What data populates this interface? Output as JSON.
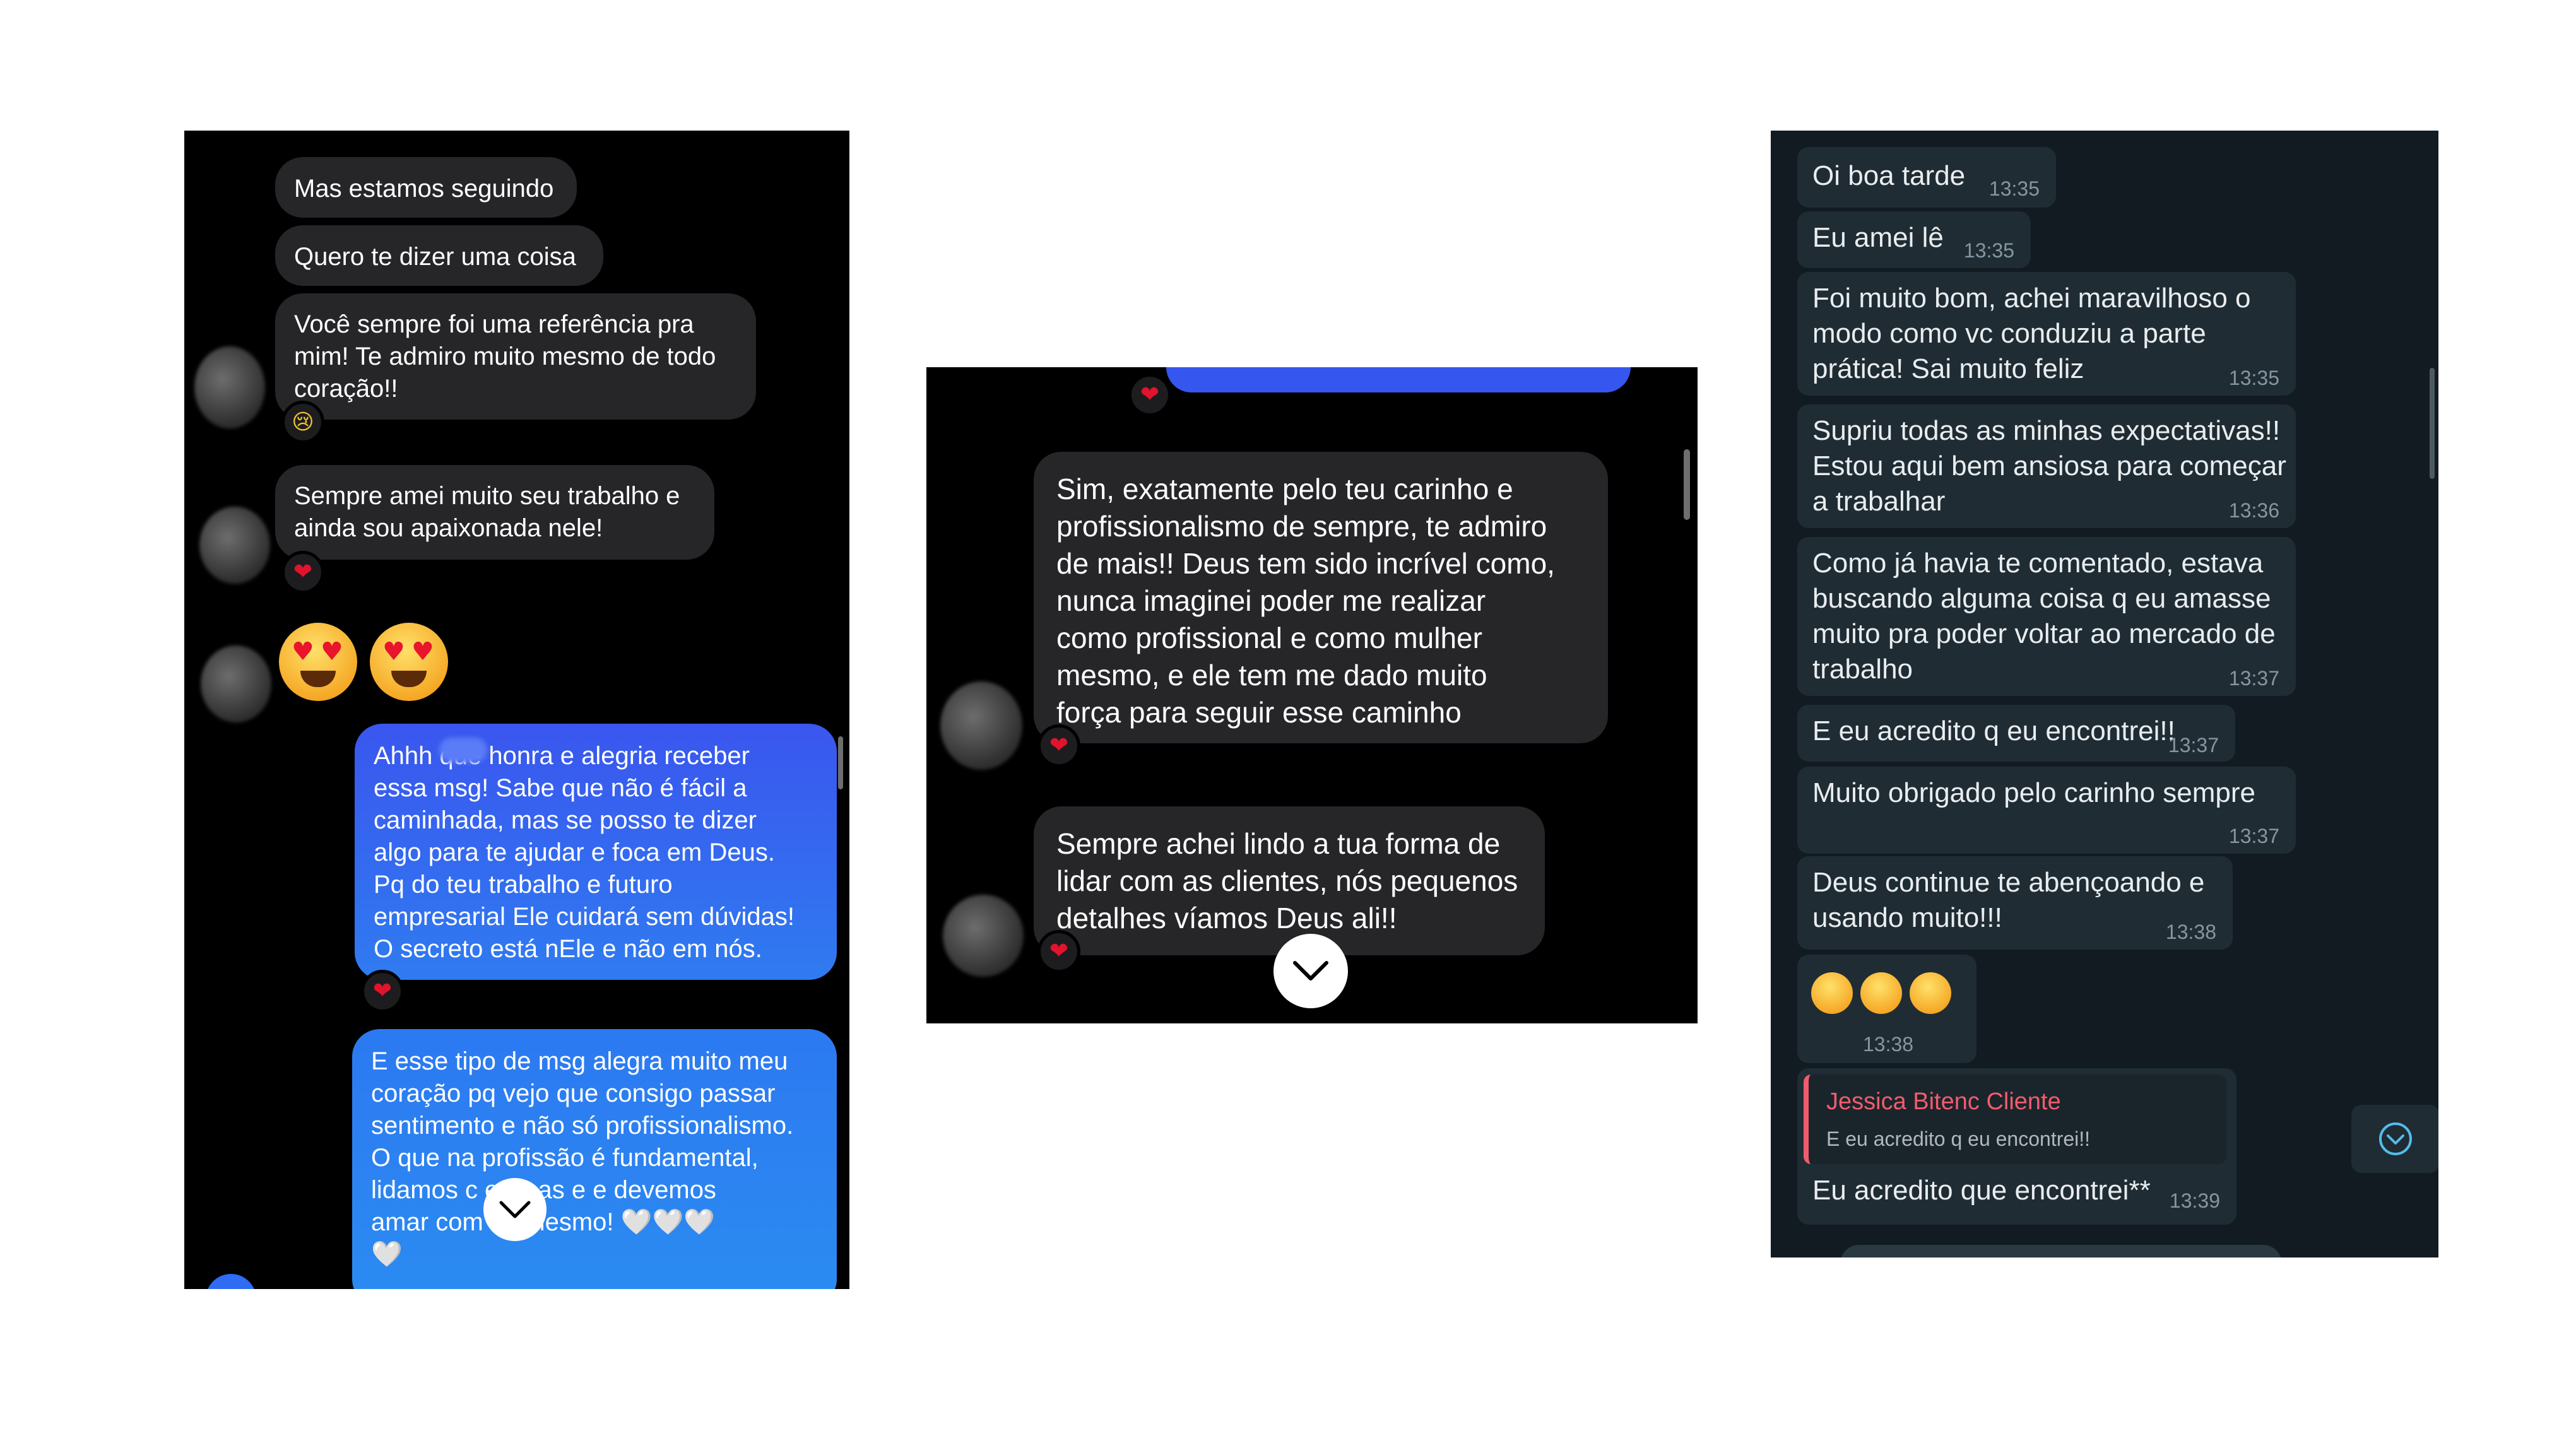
{
  "panel1": {
    "messages_in": [
      "Mas estamos seguindo",
      "Quero te dizer uma coisa",
      "Você sempre foi uma  referência pra\nmim! Te admiro muito mesmo de todo\ncoração!!",
      "Sempre amei muito seu trabalho e\nainda sou apaixonada nele!"
    ],
    "emoji_message": "😍😍",
    "messages_out": [
      "Ahhh       que honra e alegria receber\nessa msg! Sabe que não é fácil a\ncaminhada, mas se posso te dizer\nalgo para te ajudar e foca em Deus.\nPq do teu trabalho e futuro\nempresarial Ele cuidará sem dúvidas!\nO secreto está nEle e não em nós.",
      "E esse tipo de msg alegra muito meu\ncoração pq vejo que consigo passar\nsentimento e não só profissionalismo.\nO que na profissão é fundamental,\nlidamos c       essoas e e devemos\namar com       ós mesmo! 🤍🤍🤍\n🤍"
    ],
    "reactions": [
      "😢",
      "❤",
      "❤"
    ]
  },
  "panel2": {
    "messages": [
      "Sim, exatamente pelo teu carinho e\nprofissionalismo de sempre, te admiro\nde mais!! Deus tem sido incrível como,\nnunca imaginei poder me realizar\ncomo profissional e como mulher\nmesmo, e ele tem me dado muito\nforça para seguir esse caminho",
      "Sempre achei lindo a tua forma de\nlidar com as clientes, nós pequenos\ndetalhes víamos Deus ali!!"
    ],
    "reactions": [
      "❤",
      "❤",
      "❤"
    ]
  },
  "panel3": {
    "messages": [
      {
        "text": "Oi boa tarde",
        "time": "13:35"
      },
      {
        "text": "Eu amei lê",
        "time": "13:35"
      },
      {
        "text": "Foi muito bom, achei maravilhoso o\nmodo como vc conduziu a parte\nprática! Sai muito feliz",
        "time": "13:35"
      },
      {
        "text": "Supriu todas as minhas expectativas!!\nEstou aqui bem ansiosa para começar\na trabalhar",
        "time": "13:36"
      },
      {
        "text": "Como já havia te comentado, estava\nbuscando alguma coisa q eu amasse\nmuito pra poder voltar ao mercado de\ntrabalho",
        "time": "13:37"
      },
      {
        "text": "E eu acredito q eu encontrei!!",
        "time": "13:37"
      },
      {
        "text": "Muito obrigado pelo carinho sempre",
        "time": "13:37"
      },
      {
        "text": "Deus continue te abençoando e\nusando muito!!!",
        "time": "13:38"
      },
      {
        "text": "😘😘😘",
        "time": "13:38"
      }
    ],
    "reply": {
      "quote_author": "Jessica Bitenc Cliente",
      "quote_text": "E eu acredito q eu encontrei!!",
      "text": "Eu acredito que encontrei**",
      "time": "13:39"
    }
  },
  "colors": {
    "blue_bubble": "#2f6bf3",
    "dark_bubble": "#262628",
    "wa_bubble": "#1f2c34",
    "wa_bg": "#111b21",
    "quote_author": "#f15c6d"
  }
}
